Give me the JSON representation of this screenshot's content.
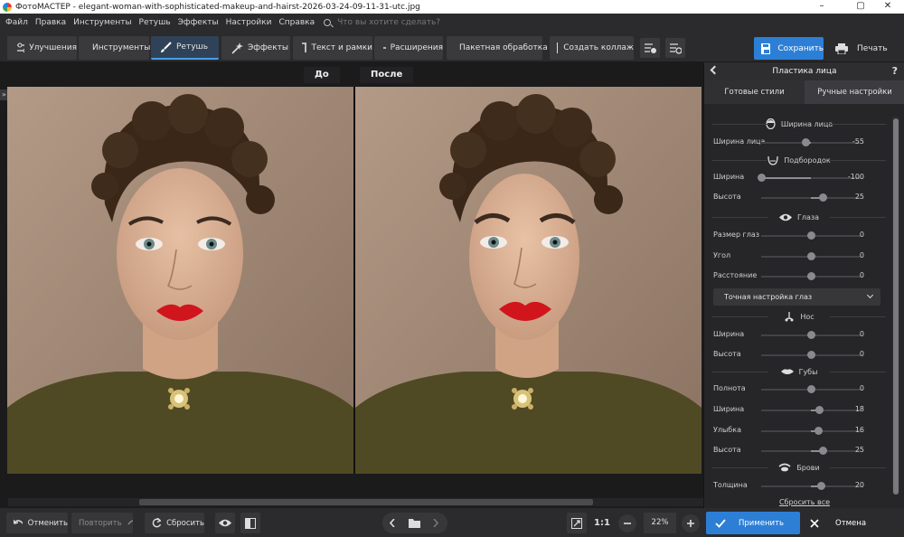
{
  "window": {
    "title": "ФотоМАСТЕР - elegant-woman-with-sophisticated-makeup-and-hairst-2026-03-24-09-11-31-utc.jpg",
    "minimize": "–",
    "maximize": "▢",
    "close": "✕"
  },
  "menu": {
    "items": [
      "Файл",
      "Правка",
      "Инструменты",
      "Ретушь",
      "Эффекты",
      "Настройки",
      "Справка"
    ],
    "search_placeholder": "Что вы хотите сделать?"
  },
  "toolbar": {
    "tabs": [
      {
        "label": "Улучшения",
        "icon": "sliders-icon"
      },
      {
        "label": "Инструменты",
        "icon": "crop-icon"
      },
      {
        "label": "Ретушь",
        "icon": "brush-icon",
        "active": true
      },
      {
        "label": "Эффекты",
        "icon": "magic-wand-icon"
      },
      {
        "label": "Текст и рамки",
        "icon": "text-icon"
      },
      {
        "label": "Расширения",
        "icon": "plus-icon"
      }
    ],
    "batch_label": "Пакетная обработка",
    "collage_label": "Создать коллаж",
    "save_label": "Сохранить",
    "print_label": "Печать"
  },
  "canvas": {
    "before_label": "До",
    "after_label": "После"
  },
  "panel": {
    "title": "Пластика лица",
    "tabs": [
      "Готовые стили",
      "Ручные настройки"
    ],
    "active_tab": "Ручные настройки",
    "sections": {
      "face": "Ширина лица",
      "chin": "Подбородок",
      "eyes": "Глаза",
      "nose": "Нос",
      "lips": "Губы",
      "brows": "Брови"
    },
    "sliders": {
      "face_width": {
        "label": "Ширина лица",
        "value": "-55",
        "pos": 0.45
      },
      "chin_width": {
        "label": "Ширина",
        "value": "-100",
        "pos": 0.0
      },
      "chin_height": {
        "label": "Высота",
        "value": "25",
        "pos": 0.62
      },
      "eye_size": {
        "label": "Размер глаз",
        "value": "0",
        "pos": 0.5
      },
      "eye_angle": {
        "label": "Угол",
        "value": "0",
        "pos": 0.5
      },
      "eye_distance": {
        "label": "Расстояние",
        "value": "0",
        "pos": 0.5
      },
      "nose_width": {
        "label": "Ширина",
        "value": "0",
        "pos": 0.5
      },
      "nose_height": {
        "label": "Высота",
        "value": "0",
        "pos": 0.5
      },
      "lip_fullness": {
        "label": "Полнота",
        "value": "0",
        "pos": 0.5
      },
      "lip_width": {
        "label": "Ширина",
        "value": "18",
        "pos": 0.59
      },
      "lip_smile": {
        "label": "Улыбка",
        "value": "16",
        "pos": 0.58
      },
      "lip_height": {
        "label": "Высота",
        "value": "25",
        "pos": 0.62
      },
      "brow_thickness": {
        "label": "Толщина",
        "value": "20",
        "pos": 0.6
      }
    },
    "eye_precise": "Точная настройка глаз",
    "reset_all": "Сбросить все"
  },
  "bottom": {
    "undo_label": "Отменить",
    "redo_label": "Повторить",
    "reset_label": "Сбросить",
    "ratio_label": "1:1",
    "zoom_value": "22%",
    "apply_label": "Применить",
    "cancel_label": "Отмена"
  },
  "colors": {
    "accent": "#2d7fd6",
    "background": "#1e1e20"
  }
}
